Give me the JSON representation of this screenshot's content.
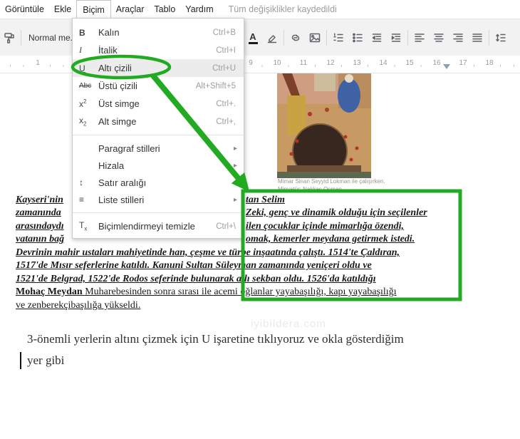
{
  "menubar": {
    "items": [
      "Görüntüle",
      "Ekle",
      "Biçim",
      "Araçlar",
      "Tablo",
      "Yardım"
    ],
    "status": "Tüm değişiklikler kaydedildi"
  },
  "toolbar": {
    "style_selector": "Normal me...",
    "dropdown_glyph": "▾",
    "text_color_label": "A"
  },
  "ruler": {
    "left_number": "1",
    "numbers": [
      "9",
      "10",
      "11",
      "12",
      "13",
      "14",
      "15",
      "16",
      "17",
      "18"
    ]
  },
  "format_menu": {
    "submenu_arrow_glyph": "▸",
    "items": [
      {
        "name": "kalin",
        "glyph": "B",
        "label": "Kalın",
        "shortcut": "Ctrl+B"
      },
      {
        "name": "italik",
        "glyph": "I",
        "label": "İtalik",
        "shortcut": "Ctrl+I"
      },
      {
        "name": "alti-cizili",
        "glyph": "U",
        "label": "Altı çizili",
        "shortcut": "Ctrl+U",
        "highlighted": true
      },
      {
        "name": "ustu-cizili",
        "glyph": "Abc",
        "label": "Üstü çizili",
        "shortcut": "Alt+Shift+5"
      },
      {
        "name": "ust-simge",
        "glyph": "x",
        "glyph_mark": "2",
        "label": "Üst simge",
        "shortcut": "Ctrl+."
      },
      {
        "name": "alt-simge",
        "glyph": "x",
        "glyph_mark": "2",
        "label": "Alt simge",
        "shortcut": "Ctrl+,"
      },
      {
        "name": "paragraf-stilleri",
        "label": "Paragraf stilleri",
        "submenu": true
      },
      {
        "name": "hizala",
        "label": "Hizala",
        "submenu": true
      },
      {
        "name": "satir-araligi",
        "glyph": "↕",
        "label": "Satır aralığı",
        "submenu": true
      },
      {
        "name": "liste-stilleri",
        "glyph": "≡",
        "label": "Liste stilleri",
        "submenu": true
      },
      {
        "name": "bicimlendirmeyi-temizle",
        "glyph": "T",
        "glyph_mark": "x",
        "label": "Biçimlendirmeyi temizle",
        "shortcut": "Ctrl+\\"
      }
    ]
  },
  "doc": {
    "caption_line1": "Mimar Sinan Seyyid Lokman ile çalışırken.",
    "caption_line2": "Minyatür: Nakkaş Osman",
    "lines_left": [
      "Kayseri'nin",
      "zamanında",
      "arasındaydı",
      "vatanın bağ"
    ],
    "lines_right": [
      "tan Selim",
      "Zeki, genç ve dinamik olduğu için seçilenler",
      "ilen çocuklar içinde mimarlığa özendi,",
      "omak, kemerler meydana getirmek istedi."
    ],
    "lines_full": [
      "Devrinin mahir ustaları mahiyetinde han, çeşme ve türbe inşaatında çalıştı. 1514'te Çaldıran,",
      "1517'de Mısır seferlerine katıldı. Kanuni Sultan Süleyman zamanında yeniçeri oldu ve",
      "1521'de Belgrad, 1522'de Rodos seferinde bulunarak atlı sekban oldu. 1526'da katıldığı"
    ],
    "line8_bold": "Mohaç Meydan",
    "line8_rest": " Muharebesinden sonra sırası ile acemi oğlanlar yayabaşılığı, kapı yayabaşılığı",
    "line9": "ve zenberekçibaşılığa yükseldi.",
    "watermark": "iyibildera.com",
    "instruction_line1": "3-önemli yerlerin altını çizmek için U işaretine tıklıyoruz ve okla gösterdiğim",
    "instruction_line2": "yer gibi"
  },
  "colors": {
    "annotation_green": "#22ab22"
  }
}
